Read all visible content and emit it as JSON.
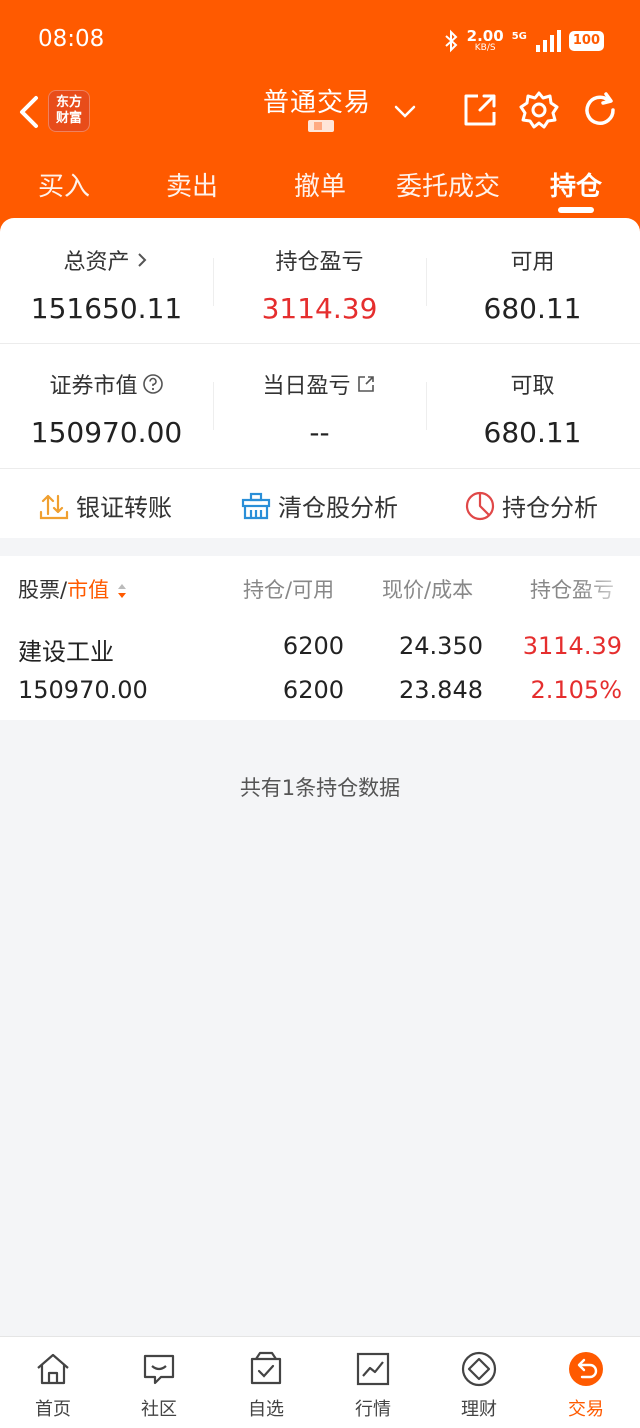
{
  "status": {
    "time": "08:08",
    "net_speed": "2.00",
    "net_unit": "KB/S",
    "signal": "5G",
    "battery": "100"
  },
  "titlebar": {
    "logo_line1": "东方",
    "logo_line2": "财富",
    "title": "普通交易"
  },
  "tabs": [
    "买入",
    "卖出",
    "撤单",
    "委托成交",
    "持仓"
  ],
  "summary": {
    "total_assets_label": "总资产",
    "total_assets": "151650.11",
    "holding_pnl_label": "持仓盈亏",
    "holding_pnl": "3114.39",
    "available_label": "可用",
    "available": "680.11",
    "market_value_label": "证券市值",
    "market_value": "150970.00",
    "daily_pnl_label": "当日盈亏",
    "daily_pnl": "--",
    "withdrawable_label": "可取",
    "withdrawable": "680.11"
  },
  "tools": {
    "transfer": "银证转账",
    "cleared": "清仓股分析",
    "analysis": "持仓分析"
  },
  "table": {
    "col1_a": "股票",
    "col1_sep": "/",
    "col1_b": "市值",
    "col2": "持仓/可用",
    "col3": "现价/成本",
    "col4": "持仓盈亏",
    "rows": [
      {
        "name": "建设工业",
        "market_value": "150970.00",
        "position": "6200",
        "available": "6200",
        "price": "24.350",
        "cost": "23.848",
        "pnl": "3114.39",
        "pnl_pct": "2.105%"
      }
    ]
  },
  "footer_note": "共有1条持仓数据",
  "nav": [
    "首页",
    "社区",
    "自选",
    "行情",
    "理财",
    "交易"
  ],
  "colors": {
    "brand": "#ff5a00",
    "profit_red": "#e52e2e",
    "background": "#f4f5f7"
  }
}
